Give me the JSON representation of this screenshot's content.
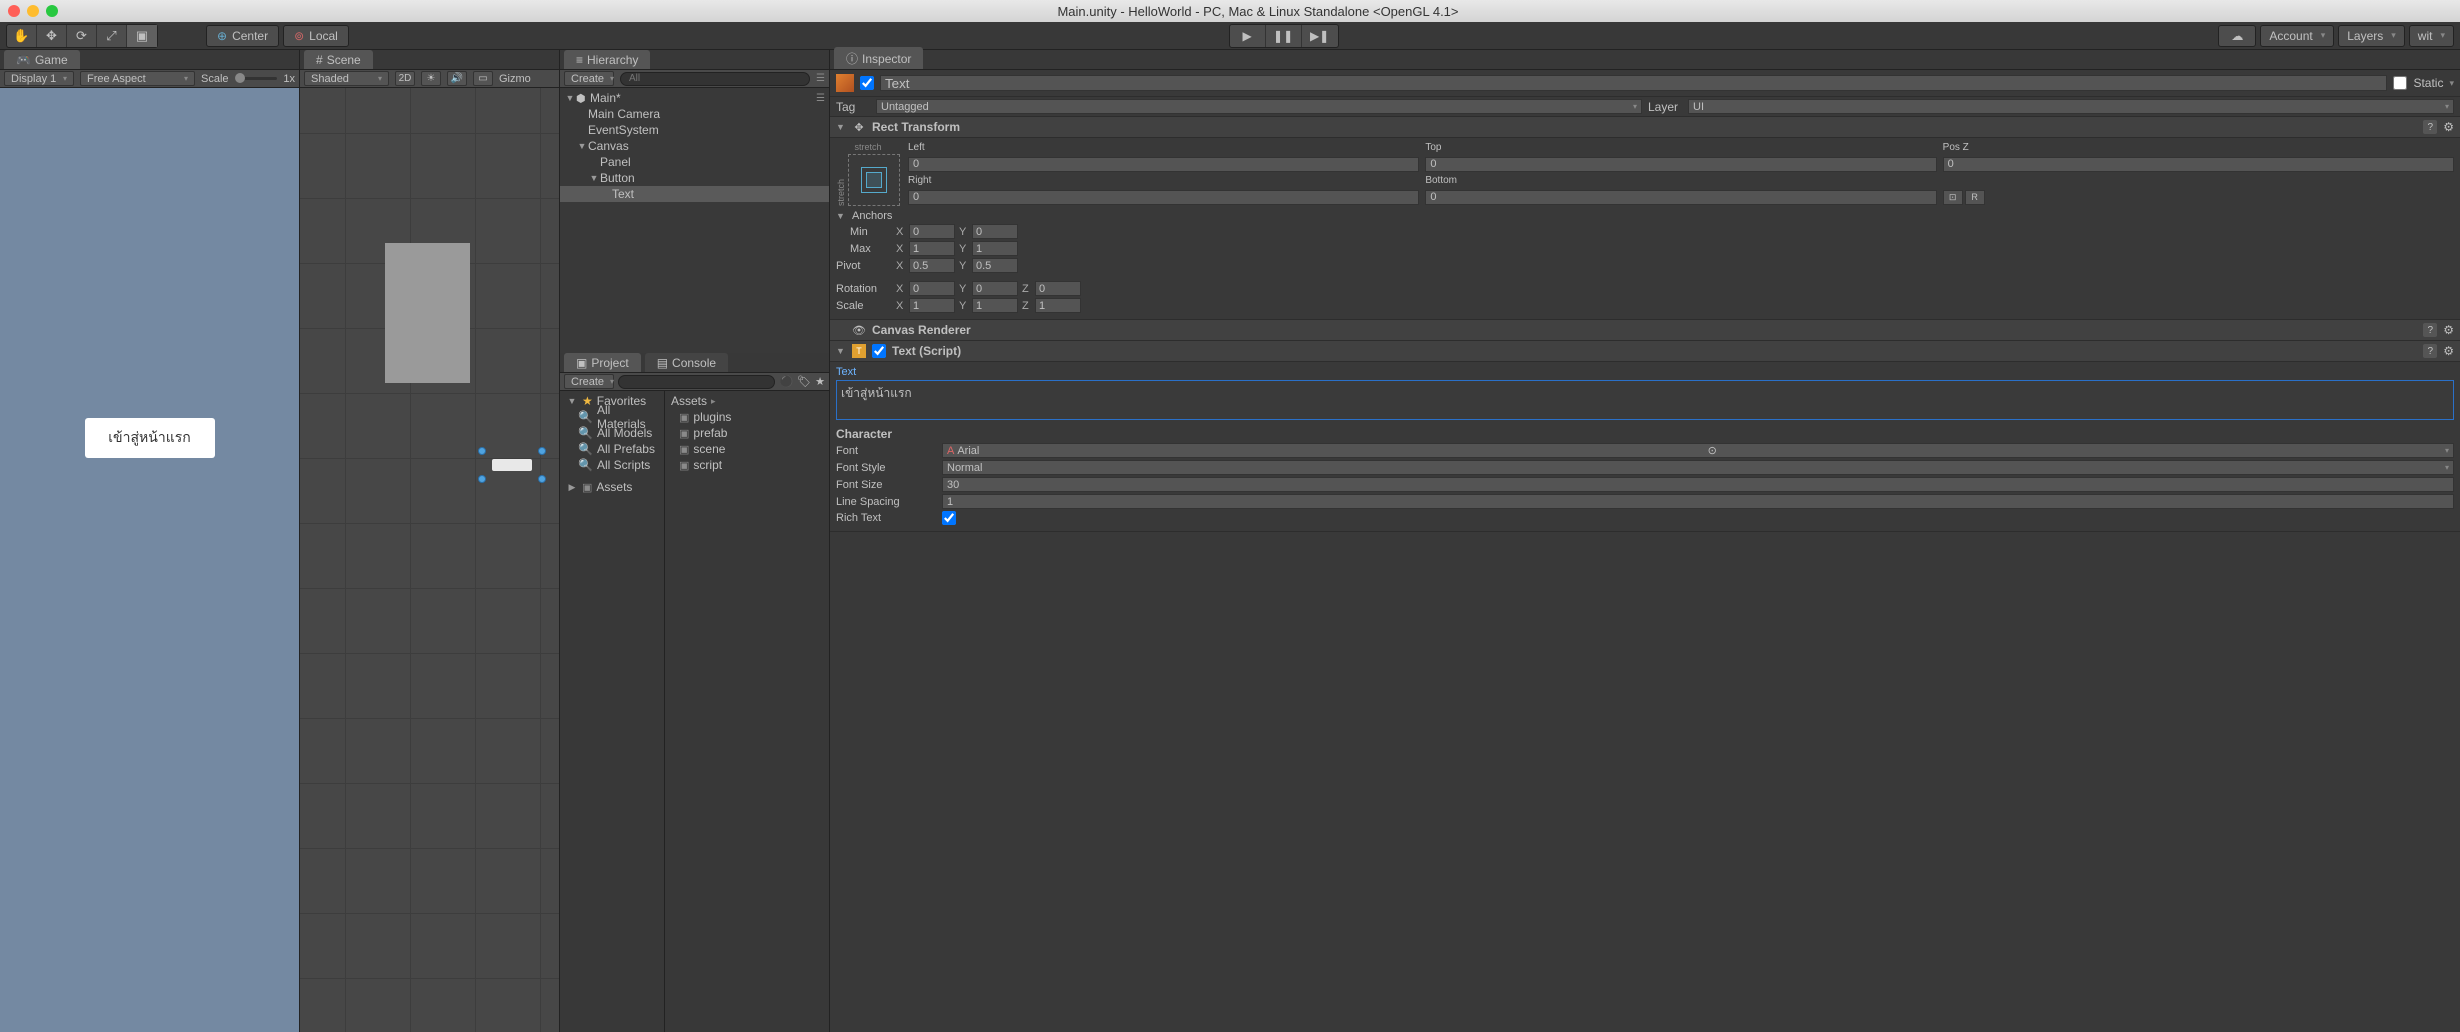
{
  "window": {
    "title": "Main.unity - HelloWorld - PC, Mac & Linux Standalone <OpenGL 4.1>"
  },
  "toolbar": {
    "center": "Center",
    "local": "Local",
    "account": "Account",
    "layers": "Layers",
    "layout": "wit"
  },
  "game": {
    "tab": "Game",
    "display": "Display 1",
    "aspect": "Free Aspect",
    "scale_label": "Scale",
    "scale_value": "1x",
    "button_text": "เข้าสู่หน้าแรก"
  },
  "scene": {
    "tab": "Scene",
    "shading": "Shaded",
    "mode2d": "2D",
    "gizmos": "Gizmo"
  },
  "hierarchy": {
    "tab": "Hierarchy",
    "create": "Create",
    "search_placeholder": "All",
    "root": "Main*",
    "items": [
      "Main Camera",
      "EventSystem",
      "Canvas",
      "Panel",
      "Button",
      "Text"
    ]
  },
  "project": {
    "tab": "Project",
    "console_tab": "Console",
    "create": "Create",
    "favorites": "Favorites",
    "fav_items": [
      "All Materials",
      "All Models",
      "All Prefabs",
      "All Scripts"
    ],
    "assets": "Assets",
    "assets_header": "Assets",
    "folders": [
      "plugins",
      "prefab",
      "scene",
      "script"
    ]
  },
  "inspector": {
    "tab": "Inspector",
    "name": "Text",
    "static": "Static",
    "tag_label": "Tag",
    "tag": "Untagged",
    "layer_label": "Layer",
    "layer": "UI",
    "rect_transform": {
      "title": "Rect Transform",
      "stretch": "stretch",
      "left_label": "Left",
      "left": "0",
      "top_label": "Top",
      "top": "0",
      "posz_label": "Pos Z",
      "posz": "0",
      "right_label": "Right",
      "right": "0",
      "bottom_label": "Bottom",
      "bottom": "0",
      "anchors": "Anchors",
      "min_label": "Min",
      "min_x": "0",
      "min_y": "0",
      "max_label": "Max",
      "max_x": "1",
      "max_y": "1",
      "pivot_label": "Pivot",
      "pivot_x": "0.5",
      "pivot_y": "0.5",
      "rotation_label": "Rotation",
      "rot_x": "0",
      "rot_y": "0",
      "rot_z": "0",
      "scale_label": "Scale",
      "scale_x": "1",
      "scale_y": "1",
      "scale_z": "1",
      "blueprint": "R"
    },
    "canvas_renderer": {
      "title": "Canvas Renderer"
    },
    "text_comp": {
      "title": "Text (Script)",
      "text_label": "Text",
      "text_value": "เข้าสู่หน้าแรก",
      "character": "Character",
      "font_label": "Font",
      "font": "Arial",
      "font_style_label": "Font Style",
      "font_style": "Normal",
      "font_size_label": "Font Size",
      "font_size": "30",
      "line_spacing_label": "Line Spacing",
      "line_spacing": "1",
      "rich_text_label": "Rich Text",
      "rich_text": true
    }
  }
}
